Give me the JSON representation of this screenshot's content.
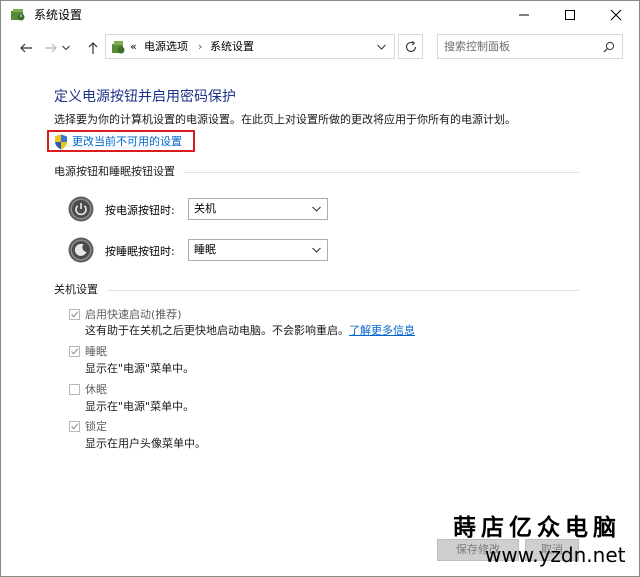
{
  "window": {
    "title": "系统设置",
    "icon": "power-options-icon"
  },
  "address_bar": {
    "overflow": "«",
    "crumbs": [
      "电源选项",
      "系统设置"
    ],
    "separator": "›"
  },
  "search": {
    "placeholder": "搜索控制面板"
  },
  "main": {
    "page_title": "定义电源按钮并启用密码保护",
    "description": "选择要为你的计算机设置的电源设置。在此页上对设置所做的更改将应用于你所有的电源计划。",
    "change_link": "更改当前不可用的设置"
  },
  "power_section": {
    "heading": "电源按钮和睡眠按钮设置",
    "power_button": {
      "label": "按电源按钮时:",
      "value": "关机"
    },
    "sleep_button": {
      "label": "按睡眠按钮时:",
      "value": "睡眠"
    }
  },
  "shutdown_section": {
    "heading": "关机设置",
    "items": [
      {
        "label": "启用快速启动(推荐)",
        "checked": true,
        "hint": "这有助于在关机之后更快地启动电脑。不会影响重启。",
        "link": "了解更多信息"
      },
      {
        "label": "睡眠",
        "checked": true,
        "hint": "显示在\"电源\"菜单中。"
      },
      {
        "label": "休眠",
        "checked": false,
        "hint": "显示在\"电源\"菜单中。"
      },
      {
        "label": "锁定",
        "checked": true,
        "hint": "显示在用户头像菜单中。"
      }
    ]
  },
  "footer": {
    "save_label": "保存修改",
    "cancel_label": "取消"
  },
  "watermark": {
    "name": "蒔店亿众电脑",
    "url": "www.yzdn.net"
  },
  "colors": {
    "title_blue": "#1e3287",
    "link_blue": "#0066cc",
    "highlight_red": "#d81e1e"
  }
}
